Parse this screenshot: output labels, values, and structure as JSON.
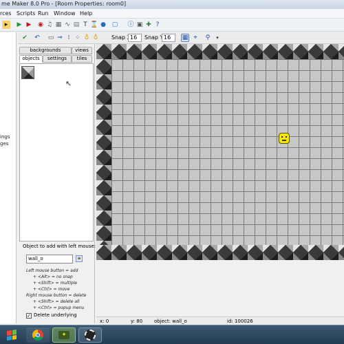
{
  "window": {
    "title": "me Maker 8.0 Pro - [Room Properties: room0]"
  },
  "menu": [
    "rces",
    "Scripts",
    "Run",
    "Window",
    "Help"
  ],
  "toolbar": {
    "icons": [
      "new-file-icon",
      "run-icon",
      "run-debug-icon",
      "sprite-icon",
      "sound-icon",
      "background-icon",
      "path-icon",
      "script-icon",
      "font-icon",
      "timeline-icon",
      "object-icon",
      "room-icon",
      "game-info-icon",
      "global-settings-icon",
      "extension-icon",
      "help-icon"
    ]
  },
  "left_tree": [
    "ings",
    "ges"
  ],
  "roombar": {
    "snap_x_label": "Snap X:",
    "snap_x_value": "16",
    "snap_y_label": "Snap Y:",
    "snap_y_value": "16"
  },
  "tabs": {
    "backgrounds": "backgrounds",
    "views": "views",
    "objects": "objects",
    "settings": "settings",
    "tiles": "tiles"
  },
  "panel": {
    "object_label": "Object to add with left mouse:",
    "object_value": "wall_o",
    "hints": [
      "Left mouse button = add",
      "+ <Alt> = no snap",
      "+ <Shift> = multiple",
      "+ <Ctrl> = move",
      "Right mouse button = delete",
      "+ <Shift> = delete all",
      "+ <Ctrl> = popup menu"
    ],
    "delete_underlying": "Delete underlying"
  },
  "status": {
    "x": "x: 0",
    "y": "y: 80",
    "object": "object: wall_o",
    "id": "id: 100026"
  },
  "colors": {
    "grid": "#c8c8c8",
    "grid_line": "#7a7a7a",
    "taskbar": "#223b52",
    "player": "#f3e600"
  }
}
